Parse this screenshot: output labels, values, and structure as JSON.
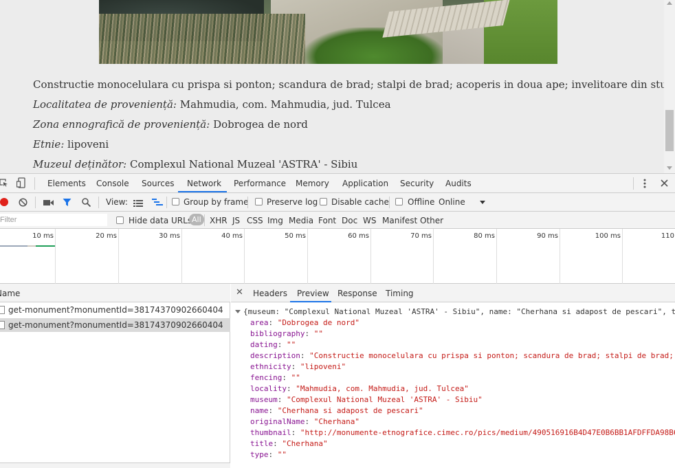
{
  "article": {
    "description": "Constructie monocelulara cu prispa si ponton; scandura de brad; stalpi de brad; acoperis in doua ape; invelitoare din stuf",
    "locality_label": "Localitatea de proveniență:",
    "locality_value": "Mahmudia, com. Mahmudia, jud. Tulcea",
    "zone_label": "Zona ennografică de proveniență:",
    "zone_value": "Dobrogea de nord",
    "ethnicity_label": "Etnie:",
    "ethnicity_value": "lipoveni",
    "museum_label": "Muzeul deținător:",
    "museum_value": "Complexul National Muzeal 'ASTRA' - Sibiu"
  },
  "devtools": {
    "tabs": [
      "Elements",
      "Console",
      "Sources",
      "Network",
      "Performance",
      "Memory",
      "Application",
      "Security",
      "Audits"
    ],
    "active_tab": "Network",
    "toolbar": {
      "view_label": "View:",
      "group_by_frame": "Group by frame",
      "preserve_log": "Preserve log",
      "disable_cache": "Disable cache",
      "offline": "Offline",
      "throttle": "Online"
    },
    "filter": {
      "placeholder": "Filter",
      "hide_data_urls": "Hide data URLs",
      "types": [
        "All",
        "XHR",
        "JS",
        "CSS",
        "Img",
        "Media",
        "Font",
        "Doc",
        "WS",
        "Manifest",
        "Other"
      ]
    },
    "timeline_ticks": [
      "10 ms",
      "20 ms",
      "30 ms",
      "40 ms",
      "50 ms",
      "60 ms",
      "70 ms",
      "80 ms",
      "90 ms",
      "100 ms",
      "110"
    ],
    "requests": {
      "header": "Name",
      "rows": [
        "get-monument?monumentId=38174370902660404",
        "get-monument?monumentId=38174370902660404"
      ]
    },
    "preview": {
      "tabs": [
        "Headers",
        "Preview",
        "Response",
        "Timing"
      ],
      "active_tab": "Preview",
      "summary": "{museum: \"Complexul National Muzeal 'ASTRA' - Sibiu\", name: \"Cherhana si adapost de pescari\", ty",
      "fields": [
        {
          "key": "area",
          "value": "\"Dobrogea de nord\""
        },
        {
          "key": "bibliography",
          "value": "\"\""
        },
        {
          "key": "dating",
          "value": "\"\""
        },
        {
          "key": "description",
          "value": "\"Constructie monocelulara cu prispa si ponton; scandura de brad; stalpi de brad;"
        },
        {
          "key": "ethnicity",
          "value": "\"lipoveni\""
        },
        {
          "key": "fencing",
          "value": "\"\""
        },
        {
          "key": "locality",
          "value": "\"Mahmudia, com. Mahmudia, jud. Tulcea\""
        },
        {
          "key": "museum",
          "value": "\"Complexul National Muzeal 'ASTRA' - Sibiu\""
        },
        {
          "key": "name",
          "value": "\"Cherhana si adapost de pescari\""
        },
        {
          "key": "originalName",
          "value": "\"Cherhana\""
        },
        {
          "key": "thumbnail",
          "value": "\"http://monumente-etnografice.cimec.ro/pics/medium/490516916B4D47E0B6BB1AFDFFDA98B6"
        },
        {
          "key": "title",
          "value": "\"Cherhana\""
        },
        {
          "key": "type",
          "value": "\"\""
        }
      ]
    }
  }
}
